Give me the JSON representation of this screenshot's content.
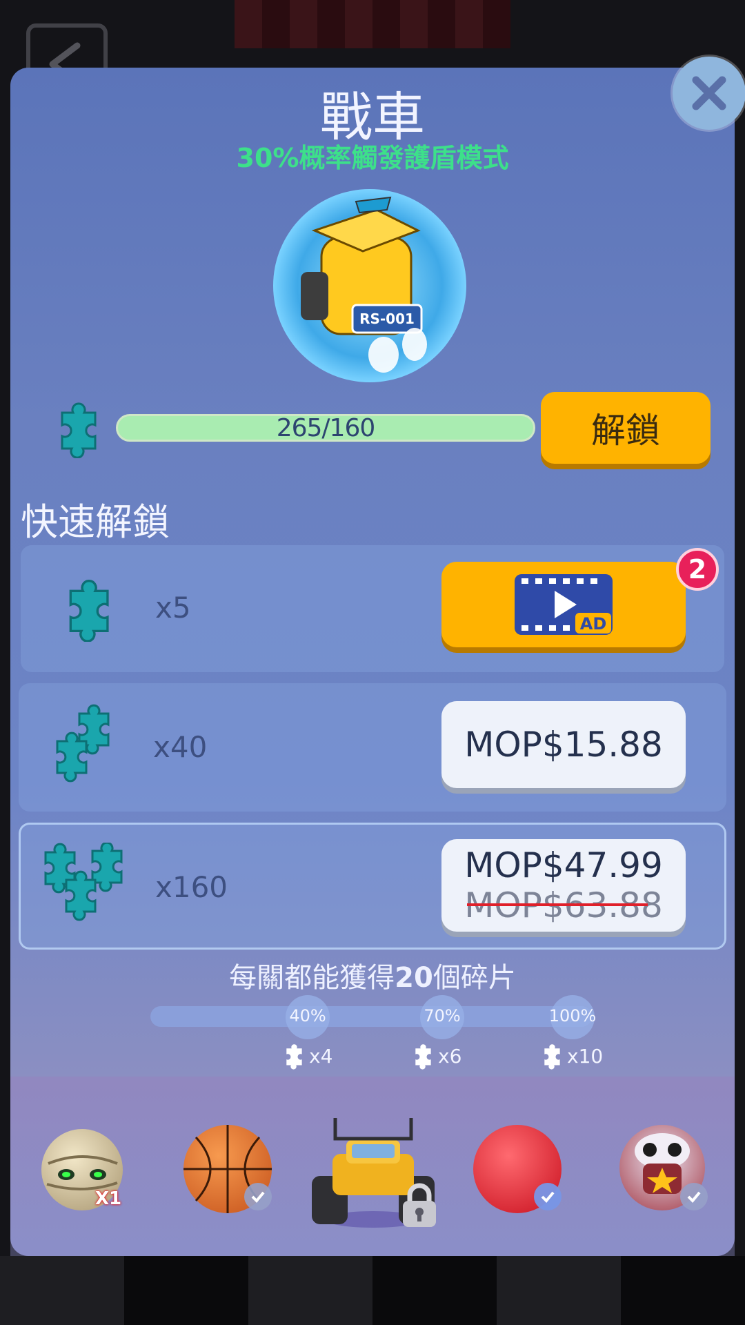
{
  "header": {
    "title": "戰車",
    "subtitle": "30%概率觸發護盾模式"
  },
  "hero": {
    "plate_text": "RS-001"
  },
  "progress": {
    "text": "265/160",
    "fraction": 1.0,
    "unlock_label": "解鎖"
  },
  "quick_unlock": {
    "title": "快速解鎖",
    "offers": [
      {
        "qty": "x5",
        "type": "ad",
        "ad_label": "AD",
        "badge": "2"
      },
      {
        "qty": "x40",
        "type": "price",
        "price": "MOP$15.88"
      },
      {
        "qty": "x160",
        "type": "price",
        "price": "MOP$47.99",
        "old_price": "MOP$63.88"
      }
    ]
  },
  "rewards": {
    "text_before": "每關都能獲得",
    "count": "20",
    "text_after": "個碎片",
    "milestones": [
      {
        "label": "40%",
        "reward": "x4"
      },
      {
        "label": "70%",
        "reward": "x6"
      },
      {
        "label": "100%",
        "reward": "x10"
      }
    ]
  },
  "carousel": {
    "items": [
      {
        "name": "mummy",
        "tag": "X1"
      },
      {
        "name": "basketball",
        "checked": true
      },
      {
        "name": "monster-truck",
        "locked": true
      },
      {
        "name": "red-ball",
        "checked": true
      },
      {
        "name": "clown-ball",
        "checked": true
      }
    ]
  },
  "colors": {
    "accent": "#ffb300",
    "subtitle": "#3de08a",
    "progress": "#a9ecb1",
    "badge": "#e8205a"
  }
}
